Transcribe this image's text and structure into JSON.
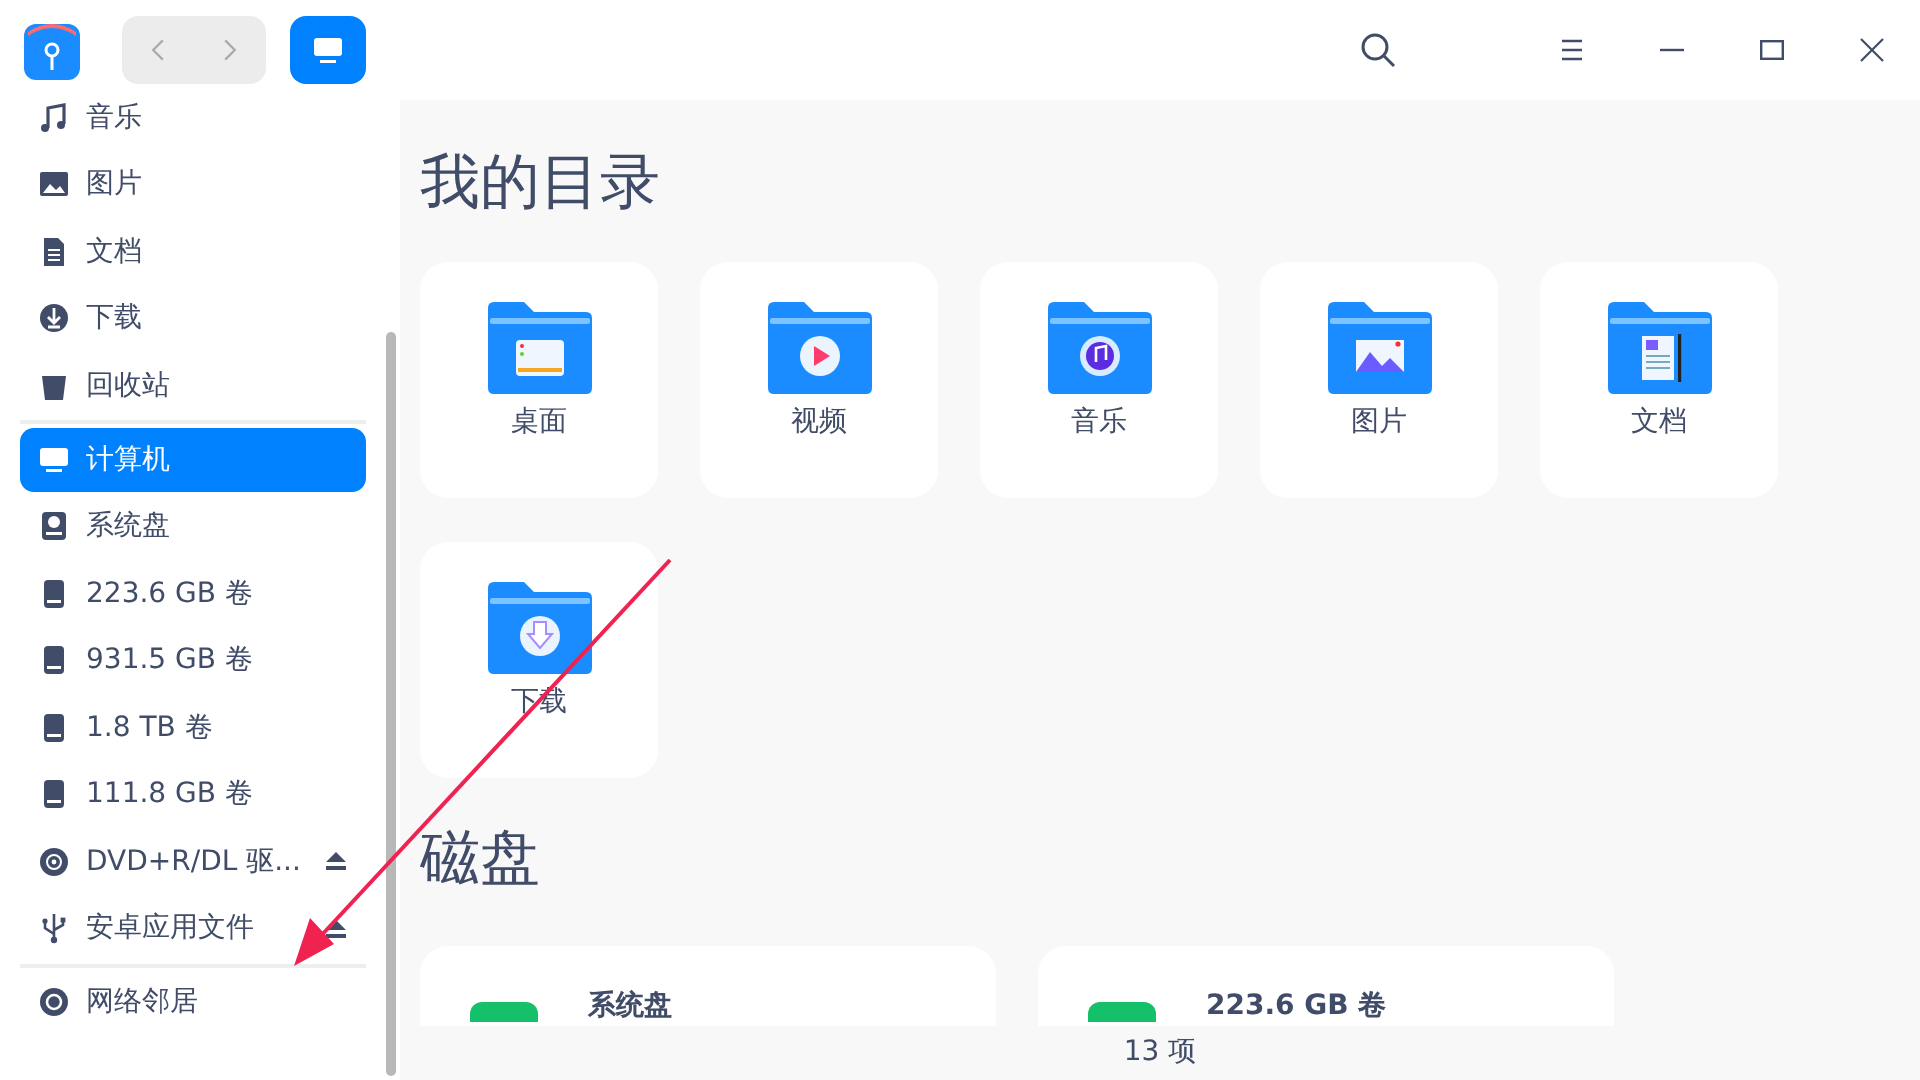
{
  "sidebar": {
    "groups": [
      [
        {
          "label": "音乐",
          "kind": "music",
          "selected": false,
          "eject": false
        },
        {
          "label": "图片",
          "kind": "picture",
          "selected": false,
          "eject": false
        },
        {
          "label": "文档",
          "kind": "document",
          "selected": false,
          "eject": false
        },
        {
          "label": "下载",
          "kind": "download",
          "selected": false,
          "eject": false
        },
        {
          "label": "回收站",
          "kind": "trash",
          "selected": false,
          "eject": false
        }
      ],
      [
        {
          "label": "计算机",
          "kind": "computer",
          "selected": true,
          "eject": false
        },
        {
          "label": "系统盘",
          "kind": "sysdisk",
          "selected": false,
          "eject": false
        },
        {
          "label": "223.6 GB 卷",
          "kind": "disk",
          "selected": false,
          "eject": false
        },
        {
          "label": "931.5 GB 卷",
          "kind": "disk",
          "selected": false,
          "eject": false
        },
        {
          "label": "1.8 TB 卷",
          "kind": "disk",
          "selected": false,
          "eject": false
        },
        {
          "label": "111.8 GB 卷",
          "kind": "disk",
          "selected": false,
          "eject": false
        },
        {
          "label": "DVD+R/DL 驱...",
          "kind": "optical",
          "selected": false,
          "eject": true
        },
        {
          "label": "安卓应用文件",
          "kind": "usb",
          "selected": false,
          "eject": true
        }
      ],
      [
        {
          "label": "网络邻居",
          "kind": "network",
          "selected": false,
          "eject": false
        }
      ]
    ]
  },
  "main": {
    "sections": [
      {
        "title": "我的目录",
        "kind": "folders",
        "items": [
          {
            "label": "桌面",
            "kind": "desktop"
          },
          {
            "label": "视频",
            "kind": "video"
          },
          {
            "label": "音乐",
            "kind": "music"
          },
          {
            "label": "图片",
            "kind": "picture"
          },
          {
            "label": "文档",
            "kind": "document"
          },
          {
            "label": "下载",
            "kind": "download"
          }
        ]
      },
      {
        "title": "磁盘",
        "kind": "disks",
        "items": [
          {
            "label": "系统盘"
          },
          {
            "label": "223.6 GB 卷"
          }
        ]
      }
    ]
  },
  "status_bar": {
    "text": "13 项"
  }
}
